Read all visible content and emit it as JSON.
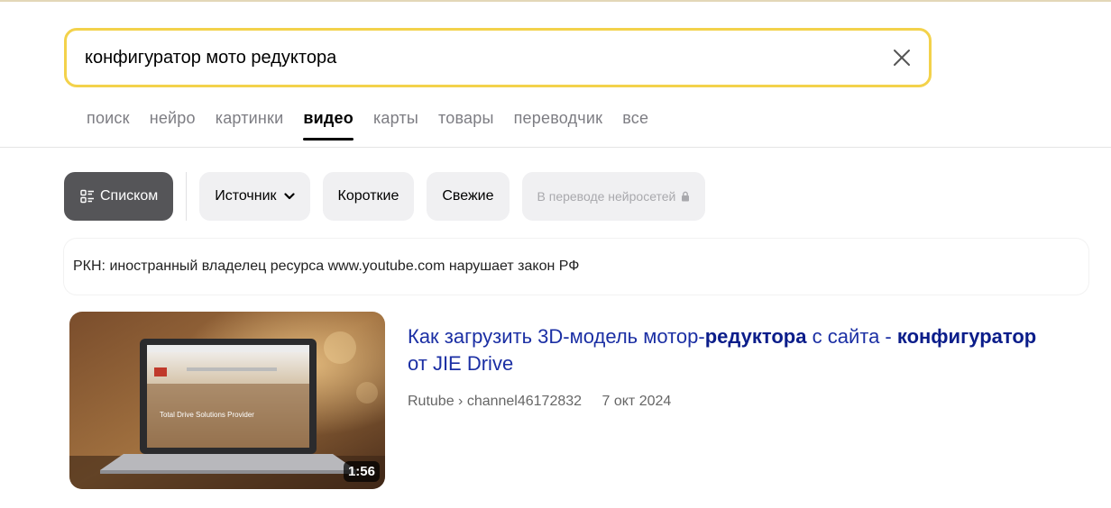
{
  "search": {
    "query": "конфигуратор мото редуктора"
  },
  "tabs": [
    {
      "label": "поиск"
    },
    {
      "label": "нейро"
    },
    {
      "label": "картинки"
    },
    {
      "label": "видео",
      "active": true
    },
    {
      "label": "карты"
    },
    {
      "label": "товары"
    },
    {
      "label": "переводчик"
    },
    {
      "label": "все"
    }
  ],
  "filters": {
    "list_view": "Списком",
    "source": "Источник",
    "short": "Короткие",
    "fresh": "Свежие",
    "neural_translation": "В переводе нейросетей"
  },
  "notice": {
    "text": "РКН: иностранный владелец ресурса www.youtube.com нарушает закон РФ"
  },
  "result": {
    "title_parts": [
      "Как загрузить 3D-модель мотор-",
      "редуктора",
      " с сайта - ",
      "конфигуратор",
      " от JIE Drive"
    ],
    "source": "Rutube › channel46172832",
    "date": "7 окт 2024",
    "duration": "1:56",
    "thumb_caption": "Total Drive Solutions Provider"
  },
  "colors": {
    "search_border": "#f3d24b",
    "link": "#1b2fa4",
    "chip_bg": "#f0f0f2",
    "chip_dark_bg": "#555558"
  }
}
